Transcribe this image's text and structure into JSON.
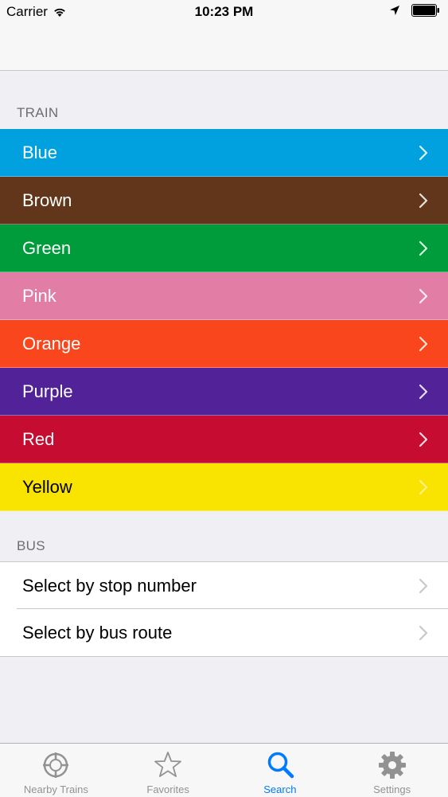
{
  "status_bar": {
    "carrier": "Carrier",
    "time": "10:23 PM"
  },
  "sections": {
    "train_header": "TRAIN",
    "bus_header": "BUS"
  },
  "train_lines": [
    {
      "label": "Blue",
      "color": "#00a1de",
      "text_color": "#ffffff"
    },
    {
      "label": "Brown",
      "color": "#62361b",
      "text_color": "#ffffff"
    },
    {
      "label": "Green",
      "color": "#009b3a",
      "text_color": "#ffffff"
    },
    {
      "label": "Pink",
      "color": "#e27ea6",
      "text_color": "#ffffff"
    },
    {
      "label": "Orange",
      "color": "#f9461c",
      "text_color": "#ffffff"
    },
    {
      "label": "Purple",
      "color": "#522398",
      "text_color": "#ffffff"
    },
    {
      "label": "Red",
      "color": "#c60c30",
      "text_color": "#ffffff"
    },
    {
      "label": "Yellow",
      "color": "#f9e300",
      "text_color": "#000000"
    }
  ],
  "bus_options": [
    {
      "label": "Select by stop number"
    },
    {
      "label": "Select by bus route"
    }
  ],
  "tab_bar": {
    "tabs": [
      {
        "label": "Nearby Trains",
        "icon": "crosshair-icon",
        "active": false
      },
      {
        "label": "Favorites",
        "icon": "star-icon",
        "active": false
      },
      {
        "label": "Search",
        "icon": "search-icon",
        "active": true
      },
      {
        "label": "Settings",
        "icon": "gear-icon",
        "active": false
      }
    ],
    "active_color": "#007aff",
    "inactive_color": "#929292"
  }
}
